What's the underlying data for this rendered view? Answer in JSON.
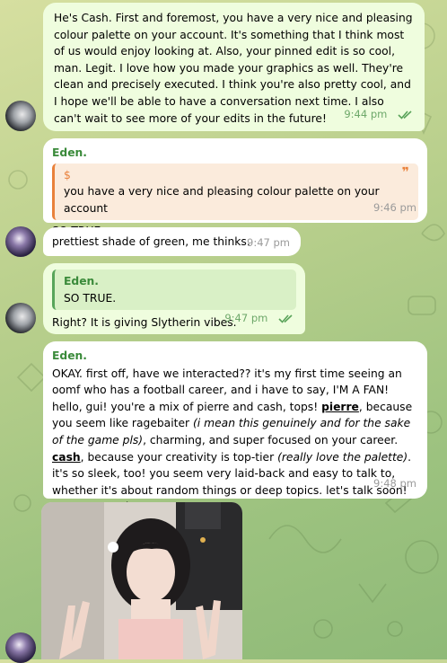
{
  "messages": {
    "m1": {
      "text": "He's Cash. First and foremost, you have a very nice and pleasing colour palette on your account. It's something that I think most of us would enjoy looking at. Also, your pinned edit is so cool, man. Legit. I love how you made your graphics as well. They're clean and precisely executed. I think you're also pretty cool, and I hope we'll be able to have a conversation next time. I also can't wait to see more of your edits in the future!",
      "time": "9:44 pm"
    },
    "m2": {
      "sender": "Eden.",
      "quote_prefix": "$",
      "quote_text": "you have a very nice and pleasing colour palette on your account",
      "text": "SO TRUE.",
      "time": "9:46 pm"
    },
    "m3": {
      "text": "prettiest shade of green, me thinks.",
      "time": "9:47 pm"
    },
    "m4": {
      "quote_sender": "Eden.",
      "quote_text": "SO TRUE.",
      "text": "Right? It is giving Slytherin vibes.",
      "time": "9:47 pm"
    },
    "m5": {
      "sender": "Eden.",
      "p1": "OKAY. first off, have we interacted?? it's my first time seeing an oomf who has a football career, and i have to say, I'M A FAN! hello, gui! you're a mix of pierre and cash, tops! ",
      "link1": "pierre",
      "p2": ", because you seem like ragebaiter ",
      "i1": "(i mean this genuinely and for the sake of the game pls)",
      "p3": ", charming, and super focused on your career. ",
      "link2": "cash",
      "p4": ", because your creativity is top-tier ",
      "i2": "(really love the palette)",
      "p5": ". it's so sleek, too! you seem very laid-back and easy to talk to, whether it's about random things or deep topics. let's talk soon! you're so cool!!",
      "time": "9:48 pm"
    }
  },
  "colors": {
    "accent": "#3a8a3a",
    "quote_orange": "#e9813b",
    "outgoing": "#effdde",
    "incoming": "#ffffff"
  },
  "icons": {
    "read": "double-check-icon"
  }
}
